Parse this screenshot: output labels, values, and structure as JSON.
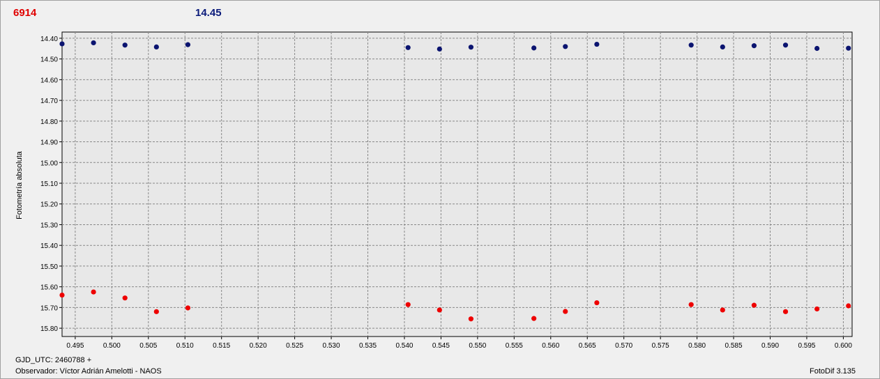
{
  "header": {
    "left_value": "6914",
    "right_value": "14.45"
  },
  "footer": {
    "gjd": "GJD_UTC: 2460788 +",
    "observer": "Observador: Víctor Adrián Amelotti - NAOS",
    "version": "FotoDif 3.135"
  },
  "colors": {
    "series_red": "#ee0000",
    "series_blue": "#0b1470",
    "plot_bg": "#e8e8e8",
    "grid": "#888888"
  },
  "chart_data": {
    "type": "scatter",
    "ylabel": "Fotometría absoluta",
    "xlabel": "",
    "xlim": [
      0.4932,
      0.6012
    ],
    "ylim": [
      15.84,
      14.37
    ],
    "y_inverted": true,
    "grid": true,
    "x_ticks": [
      "0.495",
      "0.500",
      "0.505",
      "0.510",
      "0.515",
      "0.520",
      "0.525",
      "0.530",
      "0.535",
      "0.540",
      "0.545",
      "0.550",
      "0.555",
      "0.560",
      "0.565",
      "0.570",
      "0.575",
      "0.580",
      "0.585",
      "0.590",
      "0.595",
      "0.600"
    ],
    "y_ticks": [
      "14.40",
      "14.50",
      "14.60",
      "14.70",
      "14.80",
      "14.90",
      "15.00",
      "15.10",
      "15.20",
      "15.30",
      "15.40",
      "15.50",
      "15.60",
      "15.70",
      "15.80"
    ],
    "series": [
      {
        "color": "#0b1470",
        "x": [
          0.4932,
          0.4975,
          0.5018,
          0.5061,
          0.5104,
          0.5405,
          0.5448,
          0.5491,
          0.5577,
          0.562,
          0.5663,
          0.5792,
          0.5835,
          0.5878,
          0.5921,
          0.5964,
          0.6007
        ],
        "y": [
          14.427,
          14.422,
          14.433,
          14.442,
          14.431,
          14.445,
          14.452,
          14.443,
          14.447,
          14.44,
          14.429,
          14.433,
          14.442,
          14.436,
          14.433,
          14.449,
          14.448
        ]
      },
      {
        "color": "#ee0000",
        "x": [
          0.4932,
          0.4975,
          0.5018,
          0.5061,
          0.5104,
          0.5405,
          0.5448,
          0.5491,
          0.5577,
          0.562,
          0.5663,
          0.5792,
          0.5835,
          0.5878,
          0.5921,
          0.5964,
          0.6007
        ],
        "y": [
          15.64,
          15.625,
          15.654,
          15.72,
          15.702,
          15.686,
          15.712,
          15.755,
          15.753,
          15.719,
          15.677,
          15.686,
          15.712,
          15.689,
          15.72,
          15.707,
          15.692
        ]
      }
    ]
  }
}
